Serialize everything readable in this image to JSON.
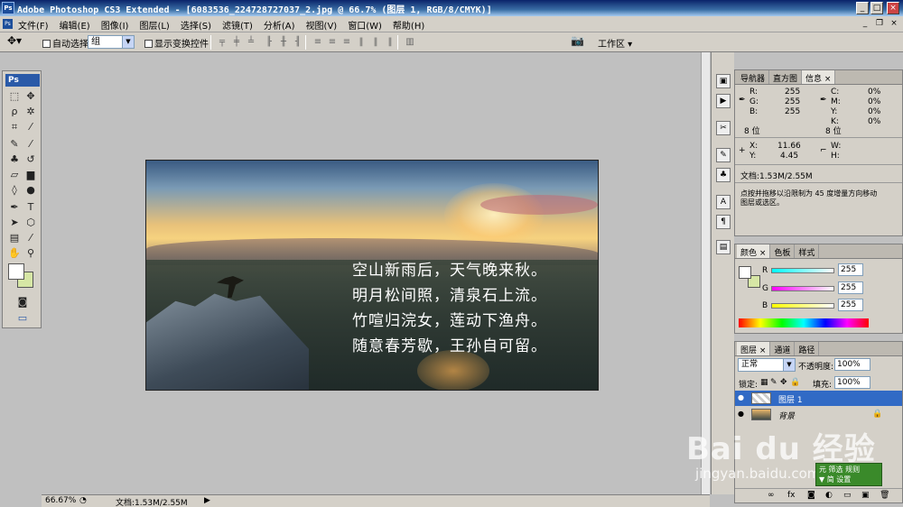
{
  "titlebar": {
    "icon": "Ps",
    "title": "Adobe Photoshop CS3 Extended - [6083536_224728727037_2.jpg @ 66.7% (图层 1, RGB/8/CMYK)]"
  },
  "menu": {
    "items": [
      "文件(F)",
      "编辑(E)",
      "图像(I)",
      "图层(L)",
      "选择(S)",
      "滤镜(T)",
      "分析(A)",
      "视图(V)",
      "窗口(W)",
      "帮助(H)"
    ]
  },
  "options": {
    "auto_select_label": "自动选择:",
    "auto_select_value": "组",
    "show_transform_label": "显示变换控件",
    "workspace_label": "工作区 ▾"
  },
  "toolbox": {
    "logo": "Ps"
  },
  "document": {
    "poem": [
      "空山新雨后，天气晚来秋。",
      "明月松间照，清泉石上流。",
      "竹喧归浣女，莲动下渔舟。",
      "随意春芳歇，王孙自可留。"
    ]
  },
  "status": {
    "zoom": "66.67%",
    "doc": "文档:1.53M/2.55M"
  },
  "info_panel": {
    "tabs": [
      "导航器",
      "直方图",
      "信息 ×"
    ],
    "r_label": "R:",
    "r_value": "255",
    "g_label": "G:",
    "g_value": "255",
    "b_label": "B:",
    "b_value": "255",
    "bit_left": "8 位",
    "c_label": "C:",
    "c_value": "0%",
    "m_label": "M:",
    "m_value": "0%",
    "y_label": "Y:",
    "y_value": "0%",
    "k_label": "K:",
    "k_value": "0%",
    "bit_right": "8 位",
    "x_label": "X:",
    "x_value": "11.66",
    "yy_label": "Y:",
    "yy_value": "4.45",
    "w_label": "W:",
    "h_label": "H:",
    "doc": "文档:1.53M/2.55M",
    "hint_line1": "点按并拖移以沿限制为 45 度增量方向移动",
    "hint_line2": "图层或选区。"
  },
  "color_panel": {
    "tabs": [
      "颜色 ×",
      "色板",
      "样式"
    ],
    "r_label": "R",
    "r_value": "255",
    "g_label": "G",
    "g_value": "255",
    "b_label": "B",
    "b_value": "255"
  },
  "layers_panel": {
    "tabs": [
      "图层 ×",
      "通道",
      "路径"
    ],
    "blend_mode": "正常",
    "opacity_label": "不透明度:",
    "opacity_value": "100%",
    "lock_label": "锁定:",
    "fill_label": "填充:",
    "fill_value": "100%",
    "layers": [
      {
        "name": "图层 1",
        "selected": true
      },
      {
        "name": "背景",
        "selected": false
      }
    ]
  },
  "watermark": {
    "brand": "Bai du 经验",
    "url": "jingyan.baidu.com"
  },
  "badge": {
    "line1": "元 筛选 规则",
    "line2": "▼ 简 设置"
  }
}
